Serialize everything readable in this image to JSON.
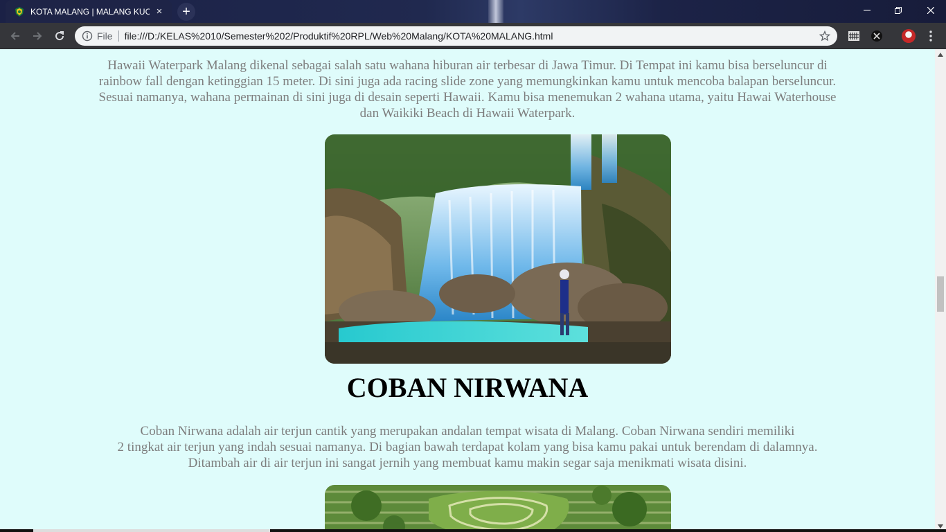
{
  "browser": {
    "tab_title": "KOTA MALANG | MALANG KUCE",
    "tab_close_glyph": "×",
    "new_tab_glyph": "+",
    "scheme_label": "File",
    "url": "file:///D:/KELAS%2010/Semester%202/Produktif%20RPL/Web%20Malang/KOTA%20MALANG.html",
    "icons": {
      "favicon": "malang-crest-icon",
      "back": "arrow-back-icon",
      "forward": "arrow-forward-icon",
      "reload": "reload-icon",
      "info": "info-icon",
      "bookmark": "star-icon",
      "extension_1": "extension-grid-icon",
      "extension_2": "extension-x-icon",
      "profile": "profile-avatar",
      "menu": "more-vert-icon",
      "minimize": "minimize-icon",
      "maximize": "restore-icon",
      "close": "close-icon"
    },
    "colors": {
      "titlebar": "#1b2146",
      "toolbar": "#35363a",
      "omnibox": "#f1f3f4"
    }
  },
  "page": {
    "background": "#dffcfb",
    "text_color": "#7d7d7d",
    "hawaii_paragraph": [
      "Hawaii Waterpark Malang dikenal sebagai salah satu wahana hiburan air terbesar di Jawa Timur. Di Tempat ini kamu bisa berseluncur di",
      "rainbow fall dengan ketinggian 15 meter. Di sini juga ada racing slide zone yang memungkinkan kamu untuk mencoba balapan berseluncur.",
      "Sesuai namanya, wahana permainan di sini juga di desain seperti Hawaii. Kamu bisa menemukan 2 wahana utama, yaitu Hawai Waterhouse",
      "dan Waikiki Beach di Hawaii Waterpark."
    ],
    "coban_heading": "COBAN NIRWANA",
    "coban_paragraph": [
      "Coban Nirwana adalah air terjun cantik yang merupakan andalan tempat wisata di Malang. Coban Nirwana sendiri memiliki",
      "2 tingkat air terjun yang indah sesuai namanya. Di bagian bawah terdapat kolam yang bisa kamu pakai untuk berendam di dalamnya.",
      "Ditambah air di air terjun ini sangat jernih yang membuat kamu makin segar saja menikmati wisata disini."
    ],
    "images": {
      "waterfall": "coban-nirwana-waterfall-photo",
      "maze": "garden-maze-photo"
    }
  }
}
